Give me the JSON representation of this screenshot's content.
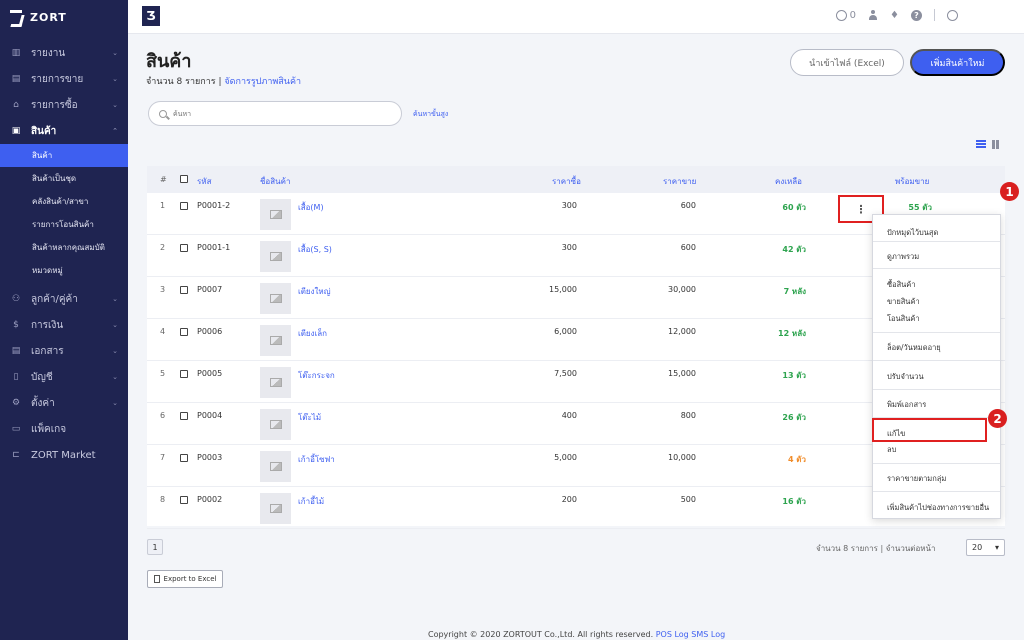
{
  "brand": {
    "name": "ZORT"
  },
  "sidebar": {
    "items": [
      {
        "label": "รายงาน",
        "icon": "chart-icon"
      },
      {
        "label": "รายการขาย",
        "icon": "clipboard-icon"
      },
      {
        "label": "รายการซื้อ",
        "icon": "basket-icon"
      },
      {
        "label": "สินค้า",
        "icon": "box-icon"
      },
      {
        "label": "ลูกค้า/คู่ค้า",
        "icon": "users-icon"
      },
      {
        "label": "การเงิน",
        "icon": "money-icon"
      },
      {
        "label": "เอกสาร",
        "icon": "document-icon"
      },
      {
        "label": "บัญชี",
        "icon": "ledger-icon"
      },
      {
        "label": "ตั้งค่า",
        "icon": "gear-icon"
      },
      {
        "label": "แพ็คเกจ",
        "icon": "package-icon"
      },
      {
        "label": "ZORT Market",
        "icon": "market-icon"
      }
    ],
    "subitems": [
      "สินค้า",
      "สินค้าเป็นชุด",
      "คลังสินค้า/สาขา",
      "รายการโอนสินค้า",
      "สินค้าหลากคุณสมบัติ",
      "หมวดหมู่"
    ]
  },
  "topbar": {
    "coin_count": "0"
  },
  "page": {
    "title": "สินค้า",
    "count_text": "จำนวน 8 รายการ | ",
    "manage_link": "จัดการรูปภาพสินค้า",
    "import_button": "นำเข้าไฟล์ (Excel)",
    "add_button": "เพิ่มสินค้าใหม่",
    "search_placeholder": "ค้นหา",
    "advanced_search": "ค้นหาขั้นสูง"
  },
  "table": {
    "headers": {
      "num": "#",
      "code": "รหัส",
      "name": "ชื่อสินค้า",
      "buy": "ราคาซื้อ",
      "sell": "ราคาขาย",
      "stock": "คงเหลือ",
      "ready": "พร้อมขาย"
    },
    "rows": [
      {
        "num": "1",
        "code": "P0001-2",
        "name": "เสื้อ(M)",
        "buy": "300",
        "sell": "600",
        "stock": "60 ตัว",
        "ready": "55 ตัว",
        "stock_color": "green"
      },
      {
        "num": "2",
        "code": "P0001-1",
        "name": "เสื้อ(S, S)",
        "buy": "300",
        "sell": "600",
        "stock": "42 ตัว",
        "ready": "",
        "stock_color": "green"
      },
      {
        "num": "3",
        "code": "P0007",
        "name": "เตียงใหญ่",
        "buy": "15,000",
        "sell": "30,000",
        "stock": "7 หลัง",
        "ready": "",
        "stock_color": "green"
      },
      {
        "num": "4",
        "code": "P0006",
        "name": "เตียงเล็ก",
        "buy": "6,000",
        "sell": "12,000",
        "stock": "12 หลัง",
        "ready": "",
        "stock_color": "green"
      },
      {
        "num": "5",
        "code": "P0005",
        "name": "โต๊ะกระจก",
        "buy": "7,500",
        "sell": "15,000",
        "stock": "13 ตัว",
        "ready": "",
        "stock_color": "green"
      },
      {
        "num": "6",
        "code": "P0004",
        "name": "โต๊ะไม้",
        "buy": "400",
        "sell": "800",
        "stock": "26 ตัว",
        "ready": "",
        "stock_color": "green"
      },
      {
        "num": "7",
        "code": "P0003",
        "name": "เก้าอี้โซฟา",
        "buy": "5,000",
        "sell": "10,000",
        "stock": "4 ตัว",
        "ready": "",
        "stock_color": "orange"
      },
      {
        "num": "8",
        "code": "P0002",
        "name": "เก้าอี้ไม้",
        "buy": "200",
        "sell": "500",
        "stock": "16 ตัว",
        "ready": "",
        "stock_color": "green"
      }
    ]
  },
  "menu": {
    "items": [
      "ปักหมุดไว้บนสุด",
      "ดูภาพรวม",
      "ซื้อสินค้า",
      "ขายสินค้า",
      "โอนสินค้า",
      "ล็อต/วันหมดอายุ",
      "ปรับจำนวน",
      "พิมพ์เอกสาร",
      "แก้ไข",
      "ลบ",
      "ราคาขายตามกลุ่ม",
      "เพิ่มสินค้าไปช่องทางการขายอื่น"
    ]
  },
  "annotations": {
    "badge1": "1",
    "badge2": "2"
  },
  "pagination": {
    "page": "1",
    "per_page_text": "จำนวน 8 รายการ | จำนวนต่อหน้า",
    "per_page_value": "20"
  },
  "export_button": "Export to Excel",
  "footer": {
    "copyright": "Copyright © 2020 ZORTOUT Co.,Ltd. All rights reserved.",
    "links": [
      "POS",
      "Log",
      "SMS Log"
    ]
  },
  "colors": {
    "sidebar": "#1f2451",
    "accent": "#3e5ff0",
    "green": "#2ea44f",
    "orange": "#f08c2a",
    "highlight": "#e02020"
  }
}
